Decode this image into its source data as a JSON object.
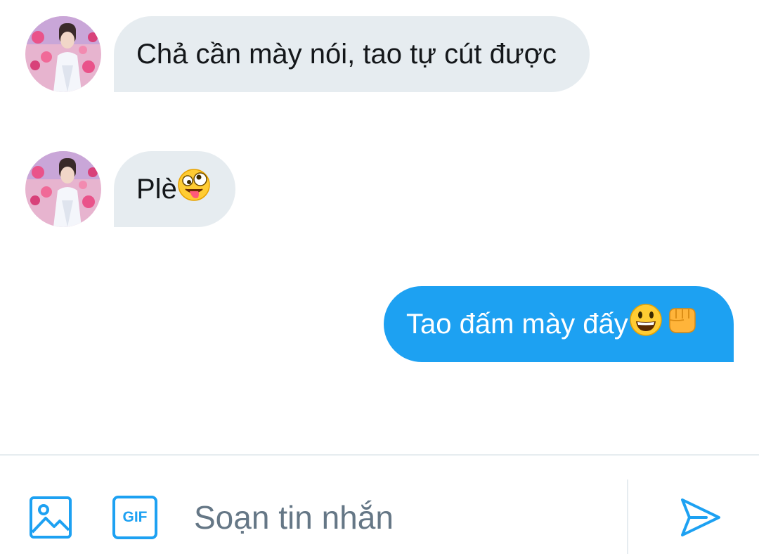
{
  "messages": [
    {
      "side": "in",
      "text": "Chả cần mày nói, tao tự cút được",
      "emoji": []
    },
    {
      "side": "in",
      "text": "Plè",
      "emoji": [
        "zany-face"
      ]
    },
    {
      "side": "out",
      "text": "Tao đấm mày đấy",
      "emoji": [
        "grinning-face",
        "oncoming-fist"
      ]
    }
  ],
  "composer": {
    "placeholder": "Soạn tin nhắn",
    "gif_label": "GIF"
  },
  "colors": {
    "accent": "#1da1f2",
    "incoming_bubble": "#e6ecf0",
    "placeholder": "#657786"
  }
}
